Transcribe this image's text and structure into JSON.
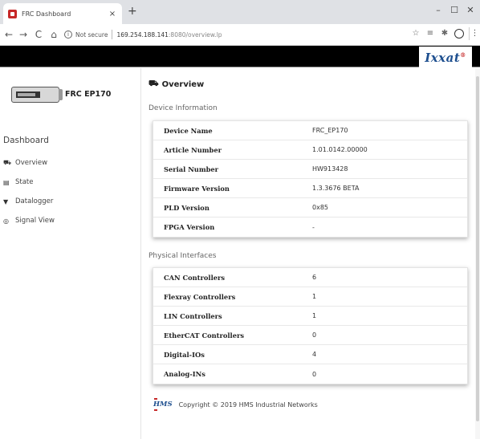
{
  "browser": {
    "tab_title": "FRC Dashboard",
    "tab_close": "×",
    "new_tab": "+",
    "window_controls": {
      "minimize": "–",
      "maximize": "☐",
      "close": "✕"
    },
    "nav": {
      "back": "←",
      "forward": "→",
      "reload": "C",
      "home": "⌂"
    },
    "address": {
      "security_label": "Not secure",
      "host": "169.254.188.141",
      "path": ":8080/overview.lp"
    }
  },
  "app": {
    "brand": "Ixxat",
    "brand_mark": "®"
  },
  "sidebar": {
    "device_name": "FRC EP170",
    "dashboard_title": "Dashboard",
    "items": [
      {
        "label": "Overview",
        "icon": "dashboard-icon"
      },
      {
        "label": "State",
        "icon": "state-icon"
      },
      {
        "label": "Datalogger",
        "icon": "datalogger-icon"
      },
      {
        "label": "Signal View",
        "icon": "signal-view-icon"
      }
    ]
  },
  "main": {
    "title": "Overview",
    "device_info": {
      "heading": "Device Information",
      "rows": [
        {
          "label": "Device Name",
          "value": "FRC_EP170"
        },
        {
          "label": "Article Number",
          "value": "1.01.0142.00000"
        },
        {
          "label": "Serial Number",
          "value": "HW913428"
        },
        {
          "label": "Firmware Version",
          "value": "1.3.3676 BETA"
        },
        {
          "label": "PLD Version",
          "value": "0x85"
        },
        {
          "label": "FPGA Version",
          "value": "-"
        }
      ]
    },
    "physical": {
      "heading": "Physical Interfaces",
      "rows": [
        {
          "label": "CAN Controllers",
          "value": "6"
        },
        {
          "label": "Flexray Controllers",
          "value": "1"
        },
        {
          "label": "LIN Controllers",
          "value": "1"
        },
        {
          "label": "EtherCAT Controllers",
          "value": "0"
        },
        {
          "label": "Digital-IOs",
          "value": "4"
        },
        {
          "label": "Analog-INs",
          "value": "0"
        }
      ]
    },
    "footer": {
      "logo": "HMS",
      "copyright": "Copyright © 2019 HMS Industrial Networks"
    }
  }
}
